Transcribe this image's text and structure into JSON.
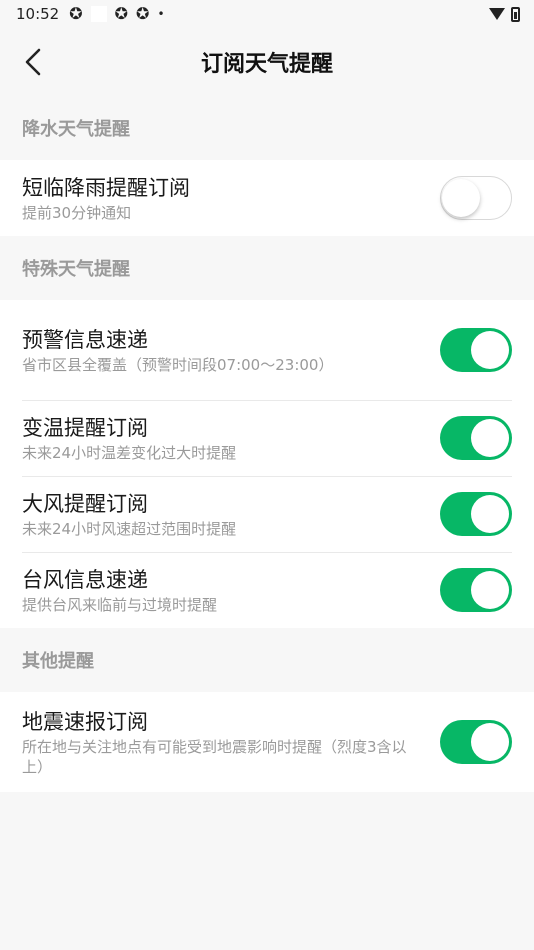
{
  "status_bar": {
    "time": "10:52",
    "icons": [
      "app-icon",
      "blank",
      "app-icon",
      "app-icon",
      "dot"
    ]
  },
  "nav": {
    "title": "订阅天气提醒"
  },
  "sections": [
    {
      "header": "降水天气提醒",
      "items": [
        {
          "title": "短临降雨提醒订阅",
          "subtitle": "提前30分钟通知",
          "enabled": false
        }
      ]
    },
    {
      "header": "特殊天气提醒",
      "items": [
        {
          "title": "预警信息速递",
          "subtitle": "省市区县全覆盖（预警时间段07:00～23:00）",
          "enabled": true
        },
        {
          "title": "变温提醒订阅",
          "subtitle": "未来24小时温差变化过大时提醒",
          "enabled": true
        },
        {
          "title": "大风提醒订阅",
          "subtitle": "未来24小时风速超过范围时提醒",
          "enabled": true
        },
        {
          "title": "台风信息速递",
          "subtitle": "提供台风来临前与过境时提醒",
          "enabled": true
        }
      ]
    },
    {
      "header": "其他提醒",
      "items": [
        {
          "title": "地震速报订阅",
          "subtitle": "所在地与关注地点有可能受到地震影响时提醒（烈度3含以上）",
          "enabled": true
        }
      ]
    }
  ],
  "colors": {
    "toggle_on": "#07b766",
    "background": "#f7f7f7",
    "section_header": "#9a9a9a"
  }
}
